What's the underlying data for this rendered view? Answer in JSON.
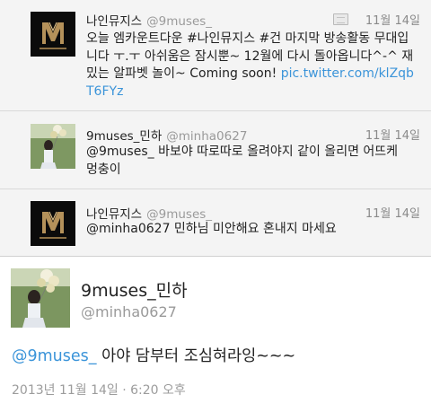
{
  "tweets": [
    {
      "name": "나인뮤지스",
      "handle": "@9muses_",
      "time": "11월 14일",
      "text_plain": "오늘 엠카운트다운 #나인뮤지스 #건 마지막 방송활동 무대입니다 ㅜ.ㅜ 아쉬움은 잠시뿐~ 12월에 다시 돌아옵니다^-^ 재밌는 알파벳 놀이~ Coming soon! ",
      "link": "pic.twitter.com/klZqbT6FYz",
      "avatar_icon": "nine-muses-logo-icon",
      "has_media": true
    },
    {
      "name": "9muses_민하",
      "handle": "@minha0627",
      "time": "11월 14일",
      "text": "@9muses_ 바보야 따로따로 올려야지 같이 올리면 어뜨케 멍충이",
      "avatar_icon": "profile-photo-icon"
    },
    {
      "name": "나인뮤지스",
      "handle": "@9muses_",
      "time": "11월 14일",
      "text": "@minha0627 민하님 미안해요 혼내지 마세요",
      "avatar_icon": "nine-muses-logo-icon"
    }
  ],
  "detail": {
    "name": "9muses_민하",
    "handle": "@minha0627",
    "mention": "@9muses_",
    "text": " 아야 담부터 조심혀라잉~~~",
    "date": "2013년 11월 14일 · 6:20 오후"
  },
  "colors": {
    "link": "#3b94d9",
    "tweet_bg": "#f4f4f4",
    "detail_bg": "#ffffff",
    "muted": "#9a9a9a"
  }
}
